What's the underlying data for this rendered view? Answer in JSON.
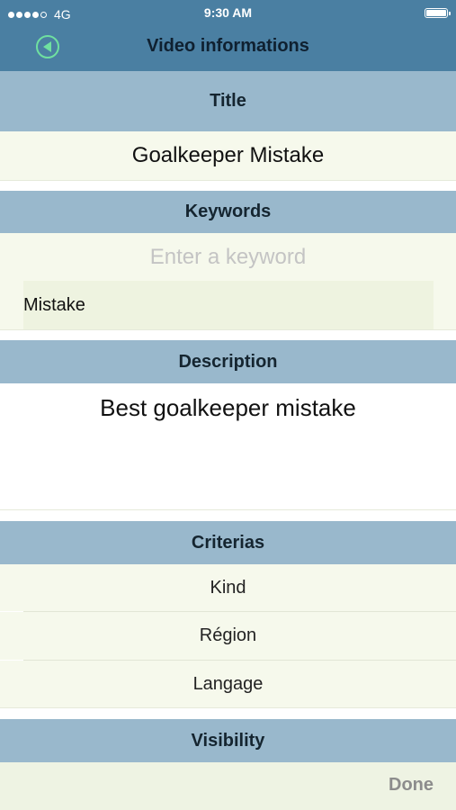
{
  "status_bar": {
    "carrier": "4G",
    "time": "9:30 AM"
  },
  "nav": {
    "title": "Video informations",
    "back_icon": "back-arrow-circle-icon"
  },
  "title_section": {
    "header": "Title",
    "value": "Goalkeeper Mistake"
  },
  "keywords_section": {
    "header": "Keywords",
    "placeholder": "Enter a keyword",
    "items": [
      "Mistake"
    ]
  },
  "description_section": {
    "header": "Description",
    "value": "Best goalkeeper mistake"
  },
  "criterias_section": {
    "header": "Criterias",
    "items": [
      "Kind",
      "Région",
      "Langage"
    ]
  },
  "visibility_section": {
    "header": "Visibility"
  },
  "keyboard_toolbar": {
    "done_label": "Done"
  },
  "colors": {
    "nav_bar": "#4a7fa2",
    "section_header": "#99b8cc",
    "row_background": "#f6f9ec",
    "back_icon": "#6fe0a0"
  }
}
